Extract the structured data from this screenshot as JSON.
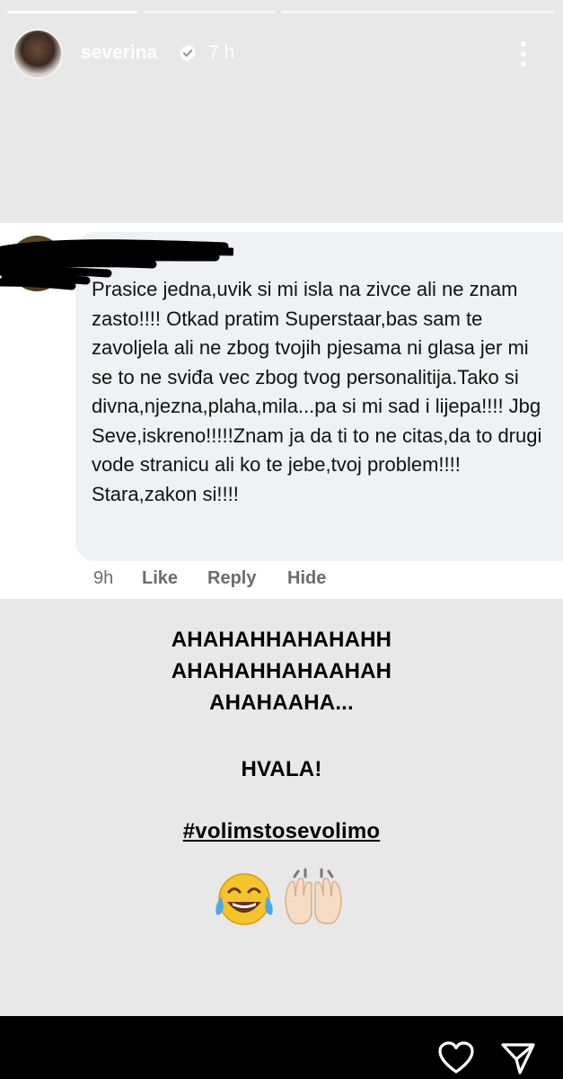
{
  "story": {
    "progress": [
      1.0,
      0.0,
      0.0
    ],
    "username": "severina",
    "time": "7 h"
  },
  "comment": {
    "text": "Prasice jedna,uvik si mi isla na zivce ali ne znam zasto!!!! Otkad pratim Superstaar,bas sam te zavoljela ali ne zbog tvojih pjesama ni glasa jer mi se to ne sviđa vec zbog tvog personalitija.Tako si divna,njezna,plaha,mila...pa si mi sad i lijepa!!!! Jbg Seve,iskreno!!!!!Znam ja da ti to ne citas,da to drugi vode stranicu ali ko te jebe,tvoj problem!!!! Stara,zakon si!!!!",
    "time": "9h",
    "like": "Like",
    "reply": "Reply",
    "hide": "Hide"
  },
  "overlay": {
    "line1": "AHAHAHHAHAHAHH",
    "line2": "AHAHAHHAHAAHAH",
    "line3": "AHAHAAHA...",
    "thanks": "HVALA!",
    "hashtag": "#volimstosevolimo"
  },
  "icons": {
    "verified": "verified-badge-icon",
    "more": "more-vertical-icon",
    "laugh": "face-with-tears-of-joy-emoji",
    "hands": "raising-hands-emoji",
    "like": "heart-icon",
    "share": "send-icon"
  },
  "colors": {
    "bubble": "#f0f1f4",
    "action_text": "#6c6c6c",
    "bottom_bar": "#000000"
  }
}
